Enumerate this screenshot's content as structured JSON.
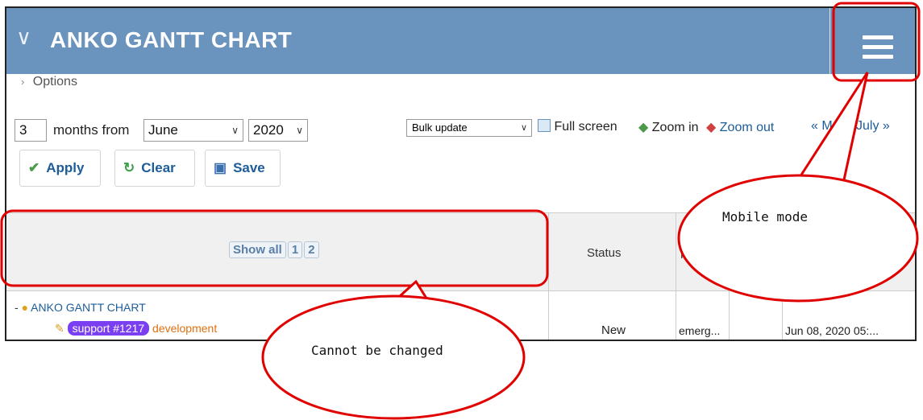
{
  "header": {
    "title": "ANKO GANTT CHART"
  },
  "options_label": "Options",
  "controls": {
    "months_value": "3",
    "months_from_label": "months from",
    "month_selected": "June",
    "year_selected": "2020",
    "bulk_update": "Bulk update",
    "full_screen": "Full screen",
    "zoom_in": "Zoom in",
    "zoom_out": "Zoom out",
    "prev_month": "« M",
    "next_month": "July »"
  },
  "buttons": {
    "apply": "Apply",
    "clear": "Clear",
    "save": "Save"
  },
  "table": {
    "pager": [
      "Show all",
      "1",
      "2"
    ],
    "status_header": "Status",
    "partial_header": "F",
    "project_name": "ANKO GANTT CHART",
    "issue_badge": "support #1217",
    "issue_label": "development",
    "status_value": "New",
    "priority_value": "emerg...",
    "date_value": "Jun 08, 2020 05:..."
  },
  "annotations": {
    "mobile_mode": "Mobile mode",
    "cannot_change": "Cannot be changed"
  },
  "colors": {
    "header": "#6a93bd",
    "annotation": "#e00000",
    "badge": "#7a3ff0"
  }
}
